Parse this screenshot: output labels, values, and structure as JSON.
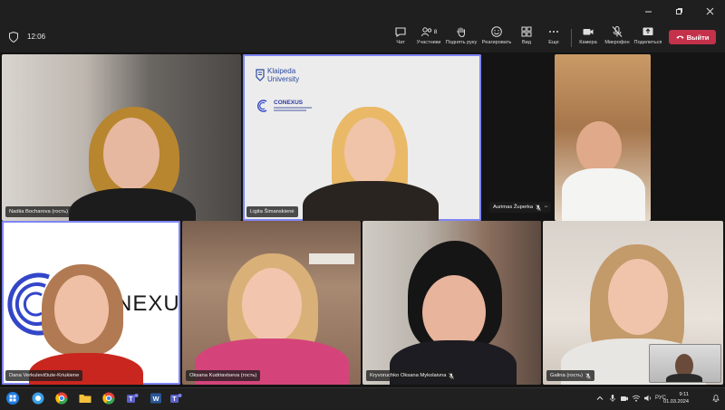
{
  "meeting": {
    "elapsed_time": "12:06",
    "toolbar": [
      {
        "key": "chat",
        "label": "Чат",
        "icon": "chat-icon"
      },
      {
        "key": "participants",
        "label": "Участники",
        "icon": "people-icon",
        "count": "8"
      },
      {
        "key": "raise_hand",
        "label": "Поднять руку",
        "icon": "hand-icon"
      },
      {
        "key": "react",
        "label": "Реагировать",
        "icon": "smiley-icon"
      },
      {
        "key": "view",
        "label": "Вид",
        "icon": "grid-icon"
      },
      {
        "key": "more",
        "label": "Еще",
        "icon": "more-icon"
      },
      {
        "key": "camera",
        "label": "Камера",
        "icon": "camera-icon"
      },
      {
        "key": "mic",
        "label": "Микрофон",
        "icon": "mic-off-icon"
      },
      {
        "key": "share",
        "label": "Поделиться",
        "icon": "share-icon"
      }
    ],
    "leave_label": "Выйти"
  },
  "participants": [
    {
      "name": "Nadiia Bocharova (гость)",
      "muted": false
    },
    {
      "name": "Ligita Šimanskienė",
      "muted": false,
      "active_speaker": true
    },
    {
      "name": "Aurimas Župerka",
      "muted": true,
      "more": "···"
    },
    {
      "name": "Dana Verkulevičiute-Kriukiene",
      "muted": false
    },
    {
      "name": "Oksana Kudriavtseva (гость)",
      "muted": false
    },
    {
      "name": "Kryvoruchko Oksana Mykolaivna",
      "muted": true
    },
    {
      "name": "Galina (гость)",
      "muted": true
    }
  ],
  "background_text": {
    "klaipeda_line1": "Klaipeda",
    "klaipeda_line2": "University",
    "conexus": "CONEXUS",
    "conexus_big": "NEXU"
  },
  "taskbar": {
    "lang": "РУС",
    "time": "9:11",
    "date": "01.03.2024"
  },
  "colors": {
    "leave": "#c4314b",
    "active_border": "#7f85f5",
    "toolbar_bg": "#1f1f1f"
  }
}
